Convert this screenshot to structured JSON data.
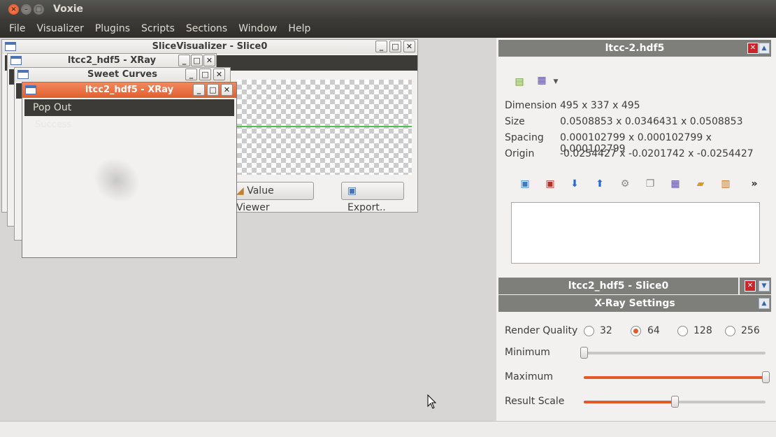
{
  "app": {
    "title": "Voxie"
  },
  "menu": [
    "File",
    "Visualizer",
    "Plugins",
    "Scripts",
    "Sections",
    "Window",
    "Help"
  ],
  "subwindows": {
    "slice_visualizer": {
      "title": "SliceVisualizer - Slice0",
      "value_viewer": "Value Viewer",
      "export": "Export.."
    },
    "xray_back": {
      "title": "ltcc2_hdf5 - XRay"
    },
    "sweet_curves": {
      "title": "Sweet Curves"
    },
    "xray_front": {
      "title": "ltcc2_hdf5 - XRay",
      "menu_item": "Pop Out",
      "status": "Success"
    }
  },
  "dataset_panel": {
    "title": "ltcc-2.hdf5",
    "properties": [
      {
        "label": "Dimension",
        "value": "495 x 337 x 495"
      },
      {
        "label": "Size",
        "value": "0.0508853 x 0.0346431 x 0.0508853"
      },
      {
        "label": "Spacing",
        "value": "0.000102799 x 0.000102799 x 0.000102799"
      },
      {
        "label": "Origin",
        "value": "-0.0254427 x -0.0201742 x -0.0254427"
      }
    ],
    "more": "»"
  },
  "slice_panel": {
    "title": "ltcc2_hdf5 - Slice0"
  },
  "xray_settings": {
    "title": "X-Ray Settings",
    "render_quality_label": "Render Quality",
    "render_quality_options": [
      "32",
      "64",
      "128",
      "256"
    ],
    "render_quality_selected": "64",
    "minimum_label": "Minimum",
    "minimum_value": 0.0,
    "maximum_label": "Maximum",
    "maximum_value": 1.0,
    "result_scale_label": "Result Scale",
    "result_scale_value": 0.5
  },
  "colors": {
    "accent": "#e05a2a",
    "title_bar": "#3c3b37",
    "active_window": "#e0602d"
  }
}
